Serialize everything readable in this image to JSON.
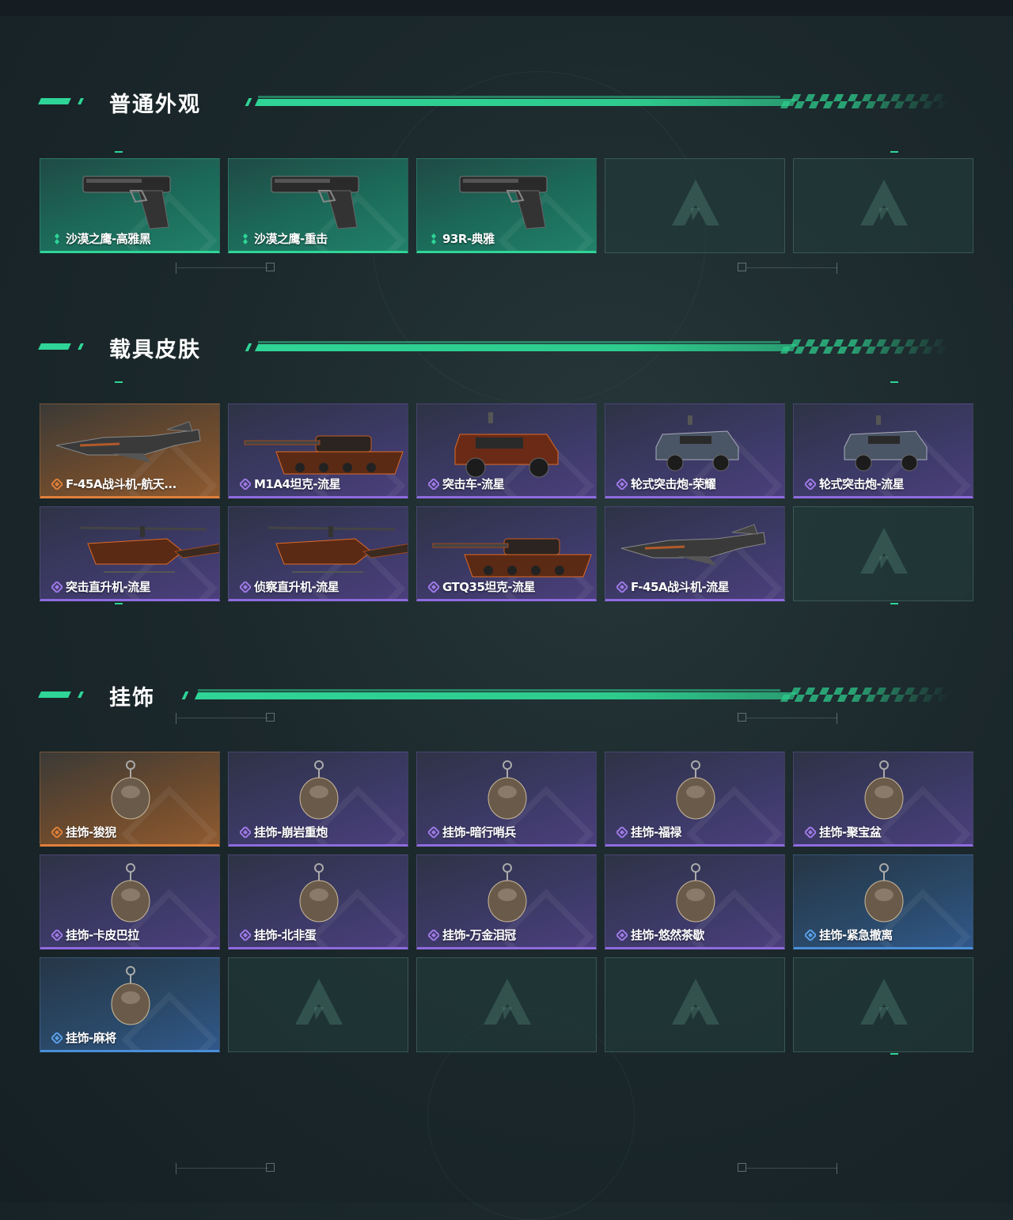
{
  "colors": {
    "accent_green": "#2fd597",
    "rarity_purple": "#8f6be0",
    "rarity_orange": "#e0803a",
    "rarity_blue": "#4a8fd8"
  },
  "sections": [
    {
      "title": "普通外观",
      "items": [
        {
          "label": "沙漠之鹰-高雅黑",
          "rarity": "green",
          "icon": "pistol-icon"
        },
        {
          "label": "沙漠之鹰-重击",
          "rarity": "green",
          "icon": "pistol-icon"
        },
        {
          "label": "93R-典雅",
          "rarity": "green",
          "icon": "pistol-icon"
        },
        {
          "label": "",
          "rarity": "empty",
          "icon": "logo-icon"
        },
        {
          "label": "",
          "rarity": "empty",
          "icon": "logo-icon"
        }
      ]
    },
    {
      "title": "载具皮肤",
      "items": [
        {
          "label": "F-45A战斗机-航天...",
          "rarity": "orange",
          "icon": "jet-icon"
        },
        {
          "label": "M1A4坦克-流星",
          "rarity": "purple",
          "icon": "tank-icon"
        },
        {
          "label": "突击车-流星",
          "rarity": "purple",
          "icon": "assault-vehicle-icon"
        },
        {
          "label": "轮式突击炮-荣耀",
          "rarity": "purple",
          "icon": "armored-car-icon"
        },
        {
          "label": "轮式突击炮-流星",
          "rarity": "purple",
          "icon": "armored-car-icon"
        },
        {
          "label": "突击直升机-流星",
          "rarity": "purple",
          "icon": "helicopter-icon"
        },
        {
          "label": "侦察直升机-流星",
          "rarity": "purple",
          "icon": "helicopter-icon"
        },
        {
          "label": "GTQ35坦克-流星",
          "rarity": "purple",
          "icon": "tank-icon"
        },
        {
          "label": "F-45A战斗机-流星",
          "rarity": "purple",
          "icon": "jet-icon"
        },
        {
          "label": "",
          "rarity": "empty",
          "icon": "logo-icon"
        }
      ]
    },
    {
      "title": "挂饰",
      "items": [
        {
          "label": "挂饰-狻猊",
          "rarity": "orange",
          "icon": "charm-icon"
        },
        {
          "label": "挂饰-崩岩重炮",
          "rarity": "purple",
          "icon": "charm-icon"
        },
        {
          "label": "挂饰-暗行哨兵",
          "rarity": "purple",
          "icon": "charm-icon"
        },
        {
          "label": "挂饰-福禄",
          "rarity": "purple",
          "icon": "charm-icon"
        },
        {
          "label": "挂饰-聚宝盆",
          "rarity": "purple",
          "icon": "charm-icon"
        },
        {
          "label": "挂饰-卡皮巴拉",
          "rarity": "purple",
          "icon": "charm-icon"
        },
        {
          "label": "挂饰-北非蛋",
          "rarity": "purple",
          "icon": "charm-icon"
        },
        {
          "label": "挂饰-万金泪冠",
          "rarity": "purple",
          "icon": "charm-icon"
        },
        {
          "label": "挂饰-悠然茶歇",
          "rarity": "purple",
          "icon": "charm-icon"
        },
        {
          "label": "挂饰-紧急撤离",
          "rarity": "blue",
          "icon": "charm-icon"
        },
        {
          "label": "挂饰-麻将",
          "rarity": "blue",
          "icon": "charm-icon"
        },
        {
          "label": "",
          "rarity": "empty",
          "icon": "logo-icon"
        },
        {
          "label": "",
          "rarity": "empty",
          "icon": "logo-icon"
        },
        {
          "label": "",
          "rarity": "empty",
          "icon": "logo-icon"
        },
        {
          "label": "",
          "rarity": "empty",
          "icon": "logo-icon"
        }
      ]
    }
  ]
}
